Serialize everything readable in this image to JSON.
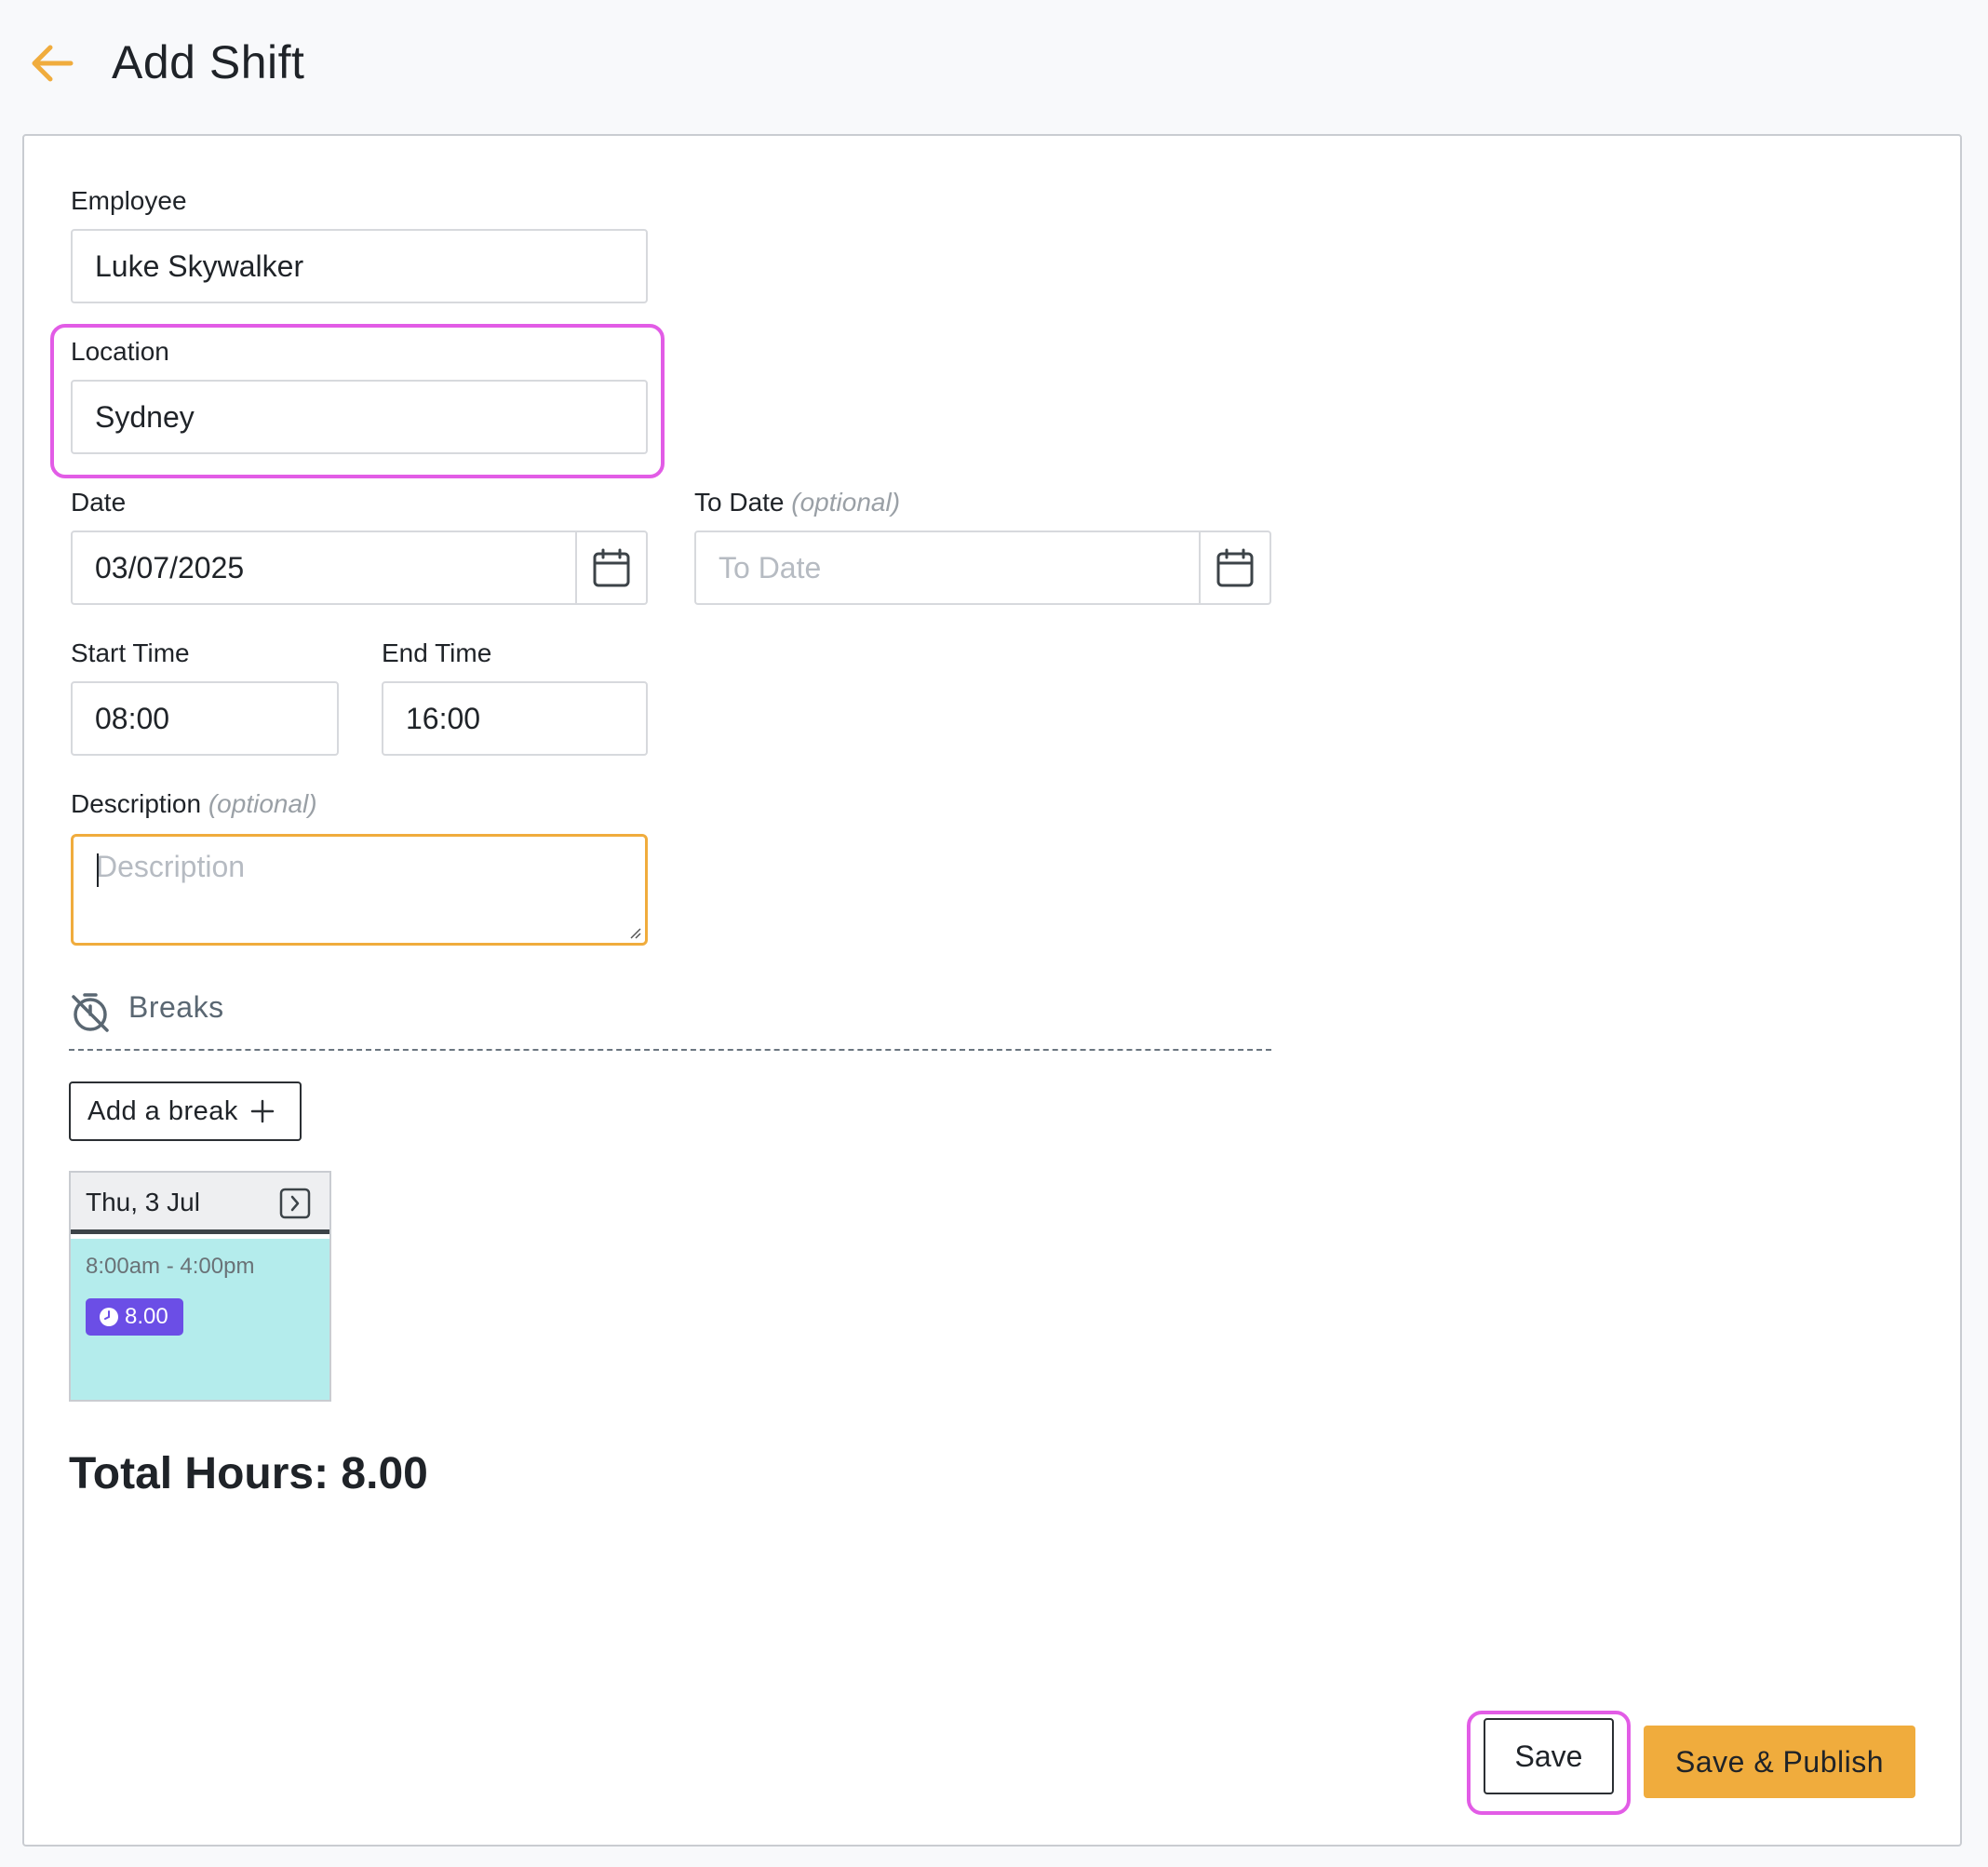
{
  "header": {
    "title": "Add Shift",
    "back_icon": "arrow-left-icon",
    "accent_color": "#f0ac3d"
  },
  "form": {
    "employee": {
      "label": "Employee",
      "value": "Luke Skywalker"
    },
    "location": {
      "label": "Location",
      "value": "Sydney",
      "highlight_color": "#e25ce6"
    },
    "date": {
      "label": "Date",
      "value": "03/07/2025",
      "icon": "calendar-icon"
    },
    "to_date": {
      "label": "To Date",
      "optional": "(optional)",
      "placeholder": "To Date",
      "icon": "calendar-icon"
    },
    "start_time": {
      "label": "Start Time",
      "value": "08:00"
    },
    "end_time": {
      "label": "End Time",
      "value": "16:00"
    },
    "description": {
      "label": "Description",
      "optional": "(optional)",
      "placeholder": "Description"
    }
  },
  "breaks": {
    "title": "Breaks",
    "icon": "timer-off-icon",
    "add_label": "Add a break"
  },
  "day_card": {
    "day": "Thu, 3 Jul",
    "range": "8:00am - 4:00pm",
    "hours": "8.00",
    "body_color": "#b4ecec",
    "badge_color": "#6b4ee6"
  },
  "total": {
    "text": "Total Hours: 8.00"
  },
  "actions": {
    "save_label": "Save",
    "publish_label": "Save & Publish"
  }
}
